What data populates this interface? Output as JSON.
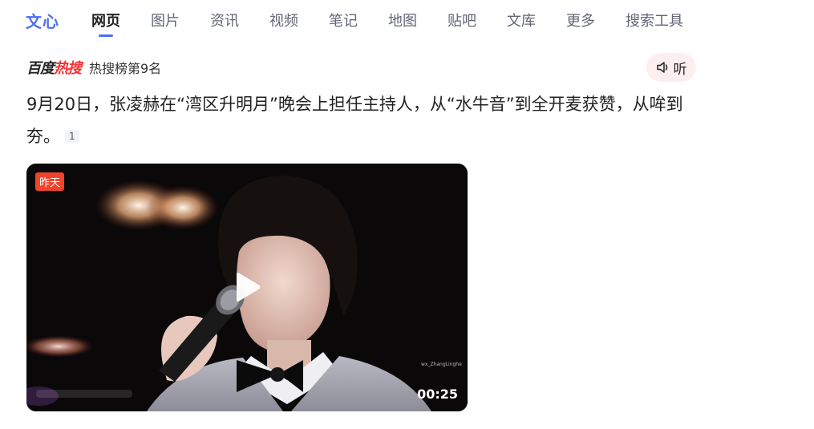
{
  "nav": {
    "brand": "文心",
    "tabs": [
      {
        "label": "网页",
        "active": true
      },
      {
        "label": "图片"
      },
      {
        "label": "资讯"
      },
      {
        "label": "视频"
      },
      {
        "label": "笔记"
      },
      {
        "label": "地图"
      },
      {
        "label": "贴吧"
      },
      {
        "label": "文库"
      },
      {
        "label": "更多"
      },
      {
        "label": "搜索工具"
      }
    ]
  },
  "hot": {
    "logo_black": "百度",
    "logo_red": "热搜",
    "rank_text": "热搜榜第9名",
    "listen_label": "听"
  },
  "headline": {
    "text": "9月20日，张凌赫在“湾区升明月”晚会上担任主持人，从“水牛音”到全开麦获赞，从哞到夯。",
    "ref": "1"
  },
  "video": {
    "tag": "昨天",
    "duration": "00:25",
    "watermark": "wx_ZhangLinghe"
  },
  "colors": {
    "accent": "#4e6ef2",
    "hot_red": "#f73131",
    "tag_red": "#f0432c",
    "listen_bg": "#fdeff0"
  }
}
